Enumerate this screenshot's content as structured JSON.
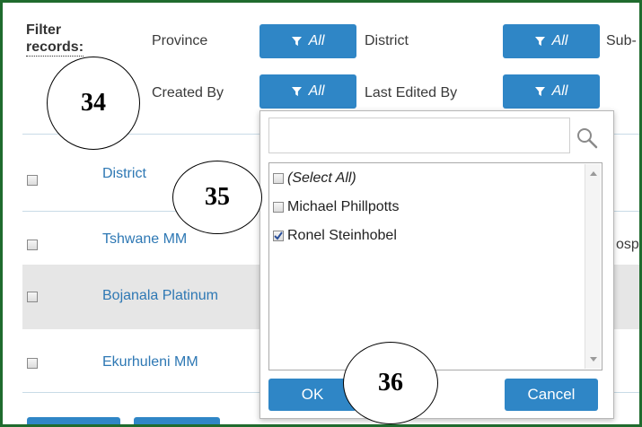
{
  "filter": {
    "title_line1": "Filter",
    "title_line2": "records:",
    "province_label": "Province",
    "district_label": "District",
    "subdistrict_label": "Sub-",
    "created_by_label": "Created By",
    "last_edited_by_label": "Last Edited By",
    "all_label": "All"
  },
  "table": {
    "header_district": "District",
    "rows": [
      {
        "district": "Tshwane MM",
        "extra": "osp",
        "checked": false
      },
      {
        "district": "Bojanala Platinum",
        "extra": "",
        "checked": false
      },
      {
        "district": "Ekurhuleni MM",
        "extra": "",
        "checked": false
      }
    ]
  },
  "popup": {
    "search_value": "",
    "items": [
      {
        "label": "(Select All)",
        "checked": false,
        "italic": true
      },
      {
        "label": "Michael Phillpotts",
        "checked": false,
        "italic": false
      },
      {
        "label": "Ronel Steinhobel",
        "checked": true,
        "italic": false
      }
    ],
    "ok_label": "OK",
    "cancel_label": "Cancel"
  },
  "callouts": {
    "a": "34",
    "b": "35",
    "c": "36"
  },
  "colors": {
    "accent": "#2f86c6",
    "frame": "#1f6b2e",
    "link": "#2e78b4"
  },
  "icons": {
    "filter": "funnel-icon",
    "search": "magnifier-icon"
  }
}
